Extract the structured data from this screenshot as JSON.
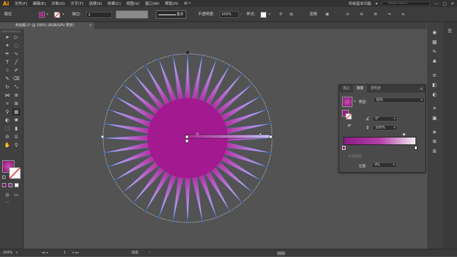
{
  "app": {
    "logo": "Ai",
    "menus": [
      "文件(F)",
      "编辑(E)",
      "对象(O)",
      "文字(T)",
      "选择(S)",
      "效果(C)",
      "视图(V)",
      "窗口(W)",
      "帮助(H)"
    ],
    "workspace": "传统基本功能",
    "stock_search": "Adobe Stock"
  },
  "controlbar": {
    "selection_label": "路径",
    "stroke_label": "描边:",
    "stroke_profile": "基本",
    "opacity_label": "不透明度:",
    "opacity_value": "100%",
    "style_label": "样式:",
    "transform_label": "变换"
  },
  "document": {
    "tab_label": "未标题-1* @ 200% (RGB/GPU 预览)"
  },
  "gradient_panel": {
    "tabs": [
      "描边",
      "渐变",
      "透明度"
    ],
    "active_tab": 1,
    "type_label": "类型:",
    "type_value": "径向",
    "angle_value": "0°",
    "ratio_value": "100%",
    "opacity_label": "不透明度:",
    "location_label": "位置:",
    "location_value": "0%"
  },
  "status": {
    "zoom": "200%",
    "page": "1",
    "tool": "渐变"
  },
  "colors": {
    "accent": "#a3198f",
    "ray_gradient_start": "#b3239b",
    "ray_gradient_end": "#c6c3f6",
    "canvas_bg": "#535353",
    "selection_blue": "#3a6fe0"
  },
  "icons": [
    "selection-tool-icon",
    "direct-select-icon",
    "magic-wand-icon",
    "lasso-icon",
    "pen-icon",
    "curvature-icon",
    "type-icon",
    "line-icon",
    "rectangle-icon",
    "paintbrush-icon",
    "pencil-icon",
    "eraser-icon",
    "rotate-icon",
    "scale-icon",
    "width-icon",
    "shape-builder-icon",
    "perspective-icon",
    "mesh-icon",
    "gradient-icon",
    "eyedropper-icon",
    "blend-icon",
    "symbol-sprayer-icon",
    "graph-icon",
    "artboard-icon",
    "slice-icon",
    "hand-icon",
    "zoom-icon"
  ]
}
